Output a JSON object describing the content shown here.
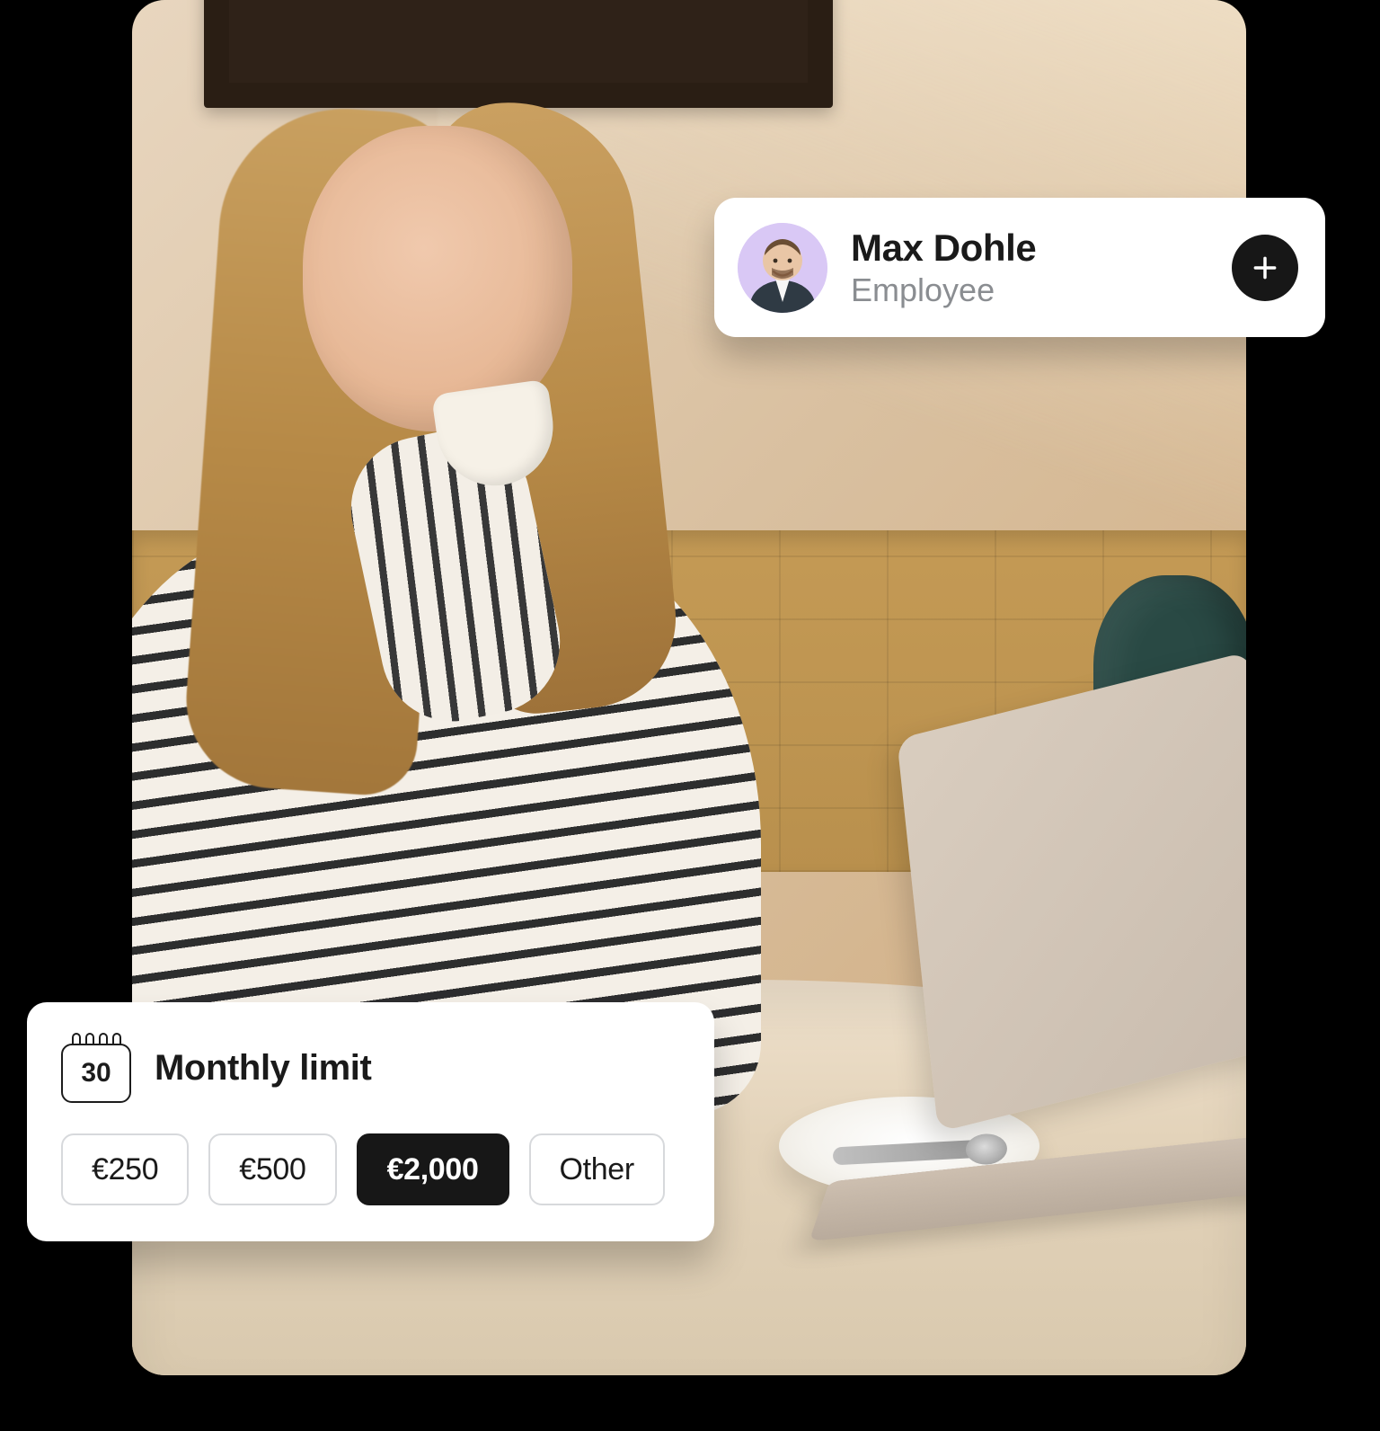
{
  "employee_card": {
    "name": "Max Dohle",
    "role": "Employee",
    "avatar_bg": "#d9c8f5"
  },
  "monthly_limit": {
    "title": "Monthly limit",
    "calendar_day": "30",
    "options": [
      "€250",
      "€500",
      "€2,000",
      "Other"
    ],
    "selected_index": 2
  }
}
